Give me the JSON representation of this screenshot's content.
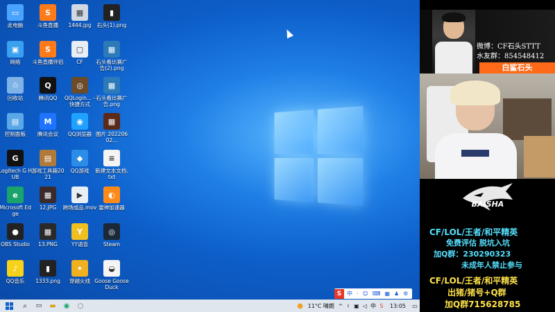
{
  "desktop": {
    "icons": [
      {
        "label": "此电脑",
        "glyph": "▭",
        "color": "#4aa3ff"
      },
      {
        "label": "斗鱼直播",
        "glyph": "S",
        "color": "#ff7a1a"
      },
      {
        "label": "1444.jpg",
        "glyph": "▦",
        "color": "#cfd8e3"
      },
      {
        "label": "石头(1).png",
        "glyph": "▮",
        "color": "#222"
      },
      {
        "label": "网络",
        "glyph": "▣",
        "color": "#3aa0f0"
      },
      {
        "label": "斗鱼直播伴侣",
        "glyph": "S",
        "color": "#ff7a1a"
      },
      {
        "label": "CF",
        "glyph": "▢",
        "color": "#e8eef6"
      },
      {
        "label": "石头看比赛广告(2).png",
        "glyph": "▦",
        "color": "#2c7ab8"
      },
      {
        "label": "回收站",
        "glyph": "♲",
        "color": "#7fb2e6"
      },
      {
        "label": "腾讯QQ",
        "glyph": "Q",
        "color": "#111"
      },
      {
        "label": "QQLogin... - 快捷方式",
        "glyph": "◎",
        "color": "#6b4b2a"
      },
      {
        "label": "石头看比赛广告.png",
        "glyph": "▦",
        "color": "#2c7ab8"
      },
      {
        "label": "控制面板",
        "glyph": "▤",
        "color": "#5aa8e8"
      },
      {
        "label": "腾讯会议",
        "glyph": "M",
        "color": "#1f74ff"
      },
      {
        "label": "QQ浏览器",
        "glyph": "◉",
        "color": "#1fa2ff"
      },
      {
        "label": "图片 20220602...",
        "glyph": "▦",
        "color": "#5a2a1a"
      },
      {
        "label": "Logitech G HUB",
        "glyph": "G",
        "color": "#111"
      },
      {
        "label": "游戏工具箱2021",
        "glyph": "▤",
        "color": "#b07a3a"
      },
      {
        "label": "QQ游戏",
        "glyph": "◆",
        "color": "#2b8de8"
      },
      {
        "label": "新建文本文档.txt",
        "glyph": "≡",
        "color": "#f4f4f4"
      },
      {
        "label": "Microsoft Edge",
        "glyph": "e",
        "color": "#1aa36a"
      },
      {
        "label": "12.JPG",
        "glyph": "▦",
        "color": "#3a2a2a"
      },
      {
        "label": "跨场成品.mov",
        "glyph": "▶",
        "color": "#e8eef6"
      },
      {
        "label": "雷神加速器",
        "glyph": "◐",
        "color": "#ff8a1a"
      },
      {
        "label": "OBS Studio",
        "glyph": "●",
        "color": "#222"
      },
      {
        "label": "13.PNG",
        "glyph": "▦",
        "color": "#2a2a2a"
      },
      {
        "label": "YY语音",
        "glyph": "Y",
        "color": "#f0c020"
      },
      {
        "label": "Steam",
        "glyph": "◎",
        "color": "#1b2838"
      },
      {
        "label": "QQ音乐",
        "glyph": "♪",
        "color": "#f6d21a"
      },
      {
        "label": "1333.png",
        "glyph": "▮",
        "color": "#222"
      },
      {
        "label": "穿越火线",
        "glyph": "✦",
        "color": "#f0b020"
      },
      {
        "label": "Goose Goose Duck",
        "glyph": "◒",
        "color": "#f4f4f4"
      }
    ]
  },
  "taskbar": {
    "weather": "11°C 晴朗",
    "time": "13:05"
  },
  "sogou_bar": {
    "items": [
      "S",
      "中",
      "·",
      "☺",
      "⌨",
      "▦",
      "♟",
      "⚙"
    ]
  },
  "sidebar": {
    "weibo": "微博：CF石头STTT",
    "fan_group": "水友群：854548412",
    "streamer_name": "白鲨石头",
    "team_logo_text": "BAISHA",
    "promo1_line1": "CF/LOL/王者/和平精英",
    "promo1_line2": "免费评估  脱坑入坑",
    "promo1_line3": "加Q群：230290323",
    "promo1_line4": "未成年人禁止参与",
    "promo2_line1": "CF/LOL/王者/和平精英",
    "promo2_line2": "出猪/猪号+Q群",
    "promo2_line3": "加Q群715628785"
  },
  "colors": {
    "accent": "#ff6a1a",
    "cyan": "#55e0ff",
    "yellow": "#ffe24a"
  }
}
